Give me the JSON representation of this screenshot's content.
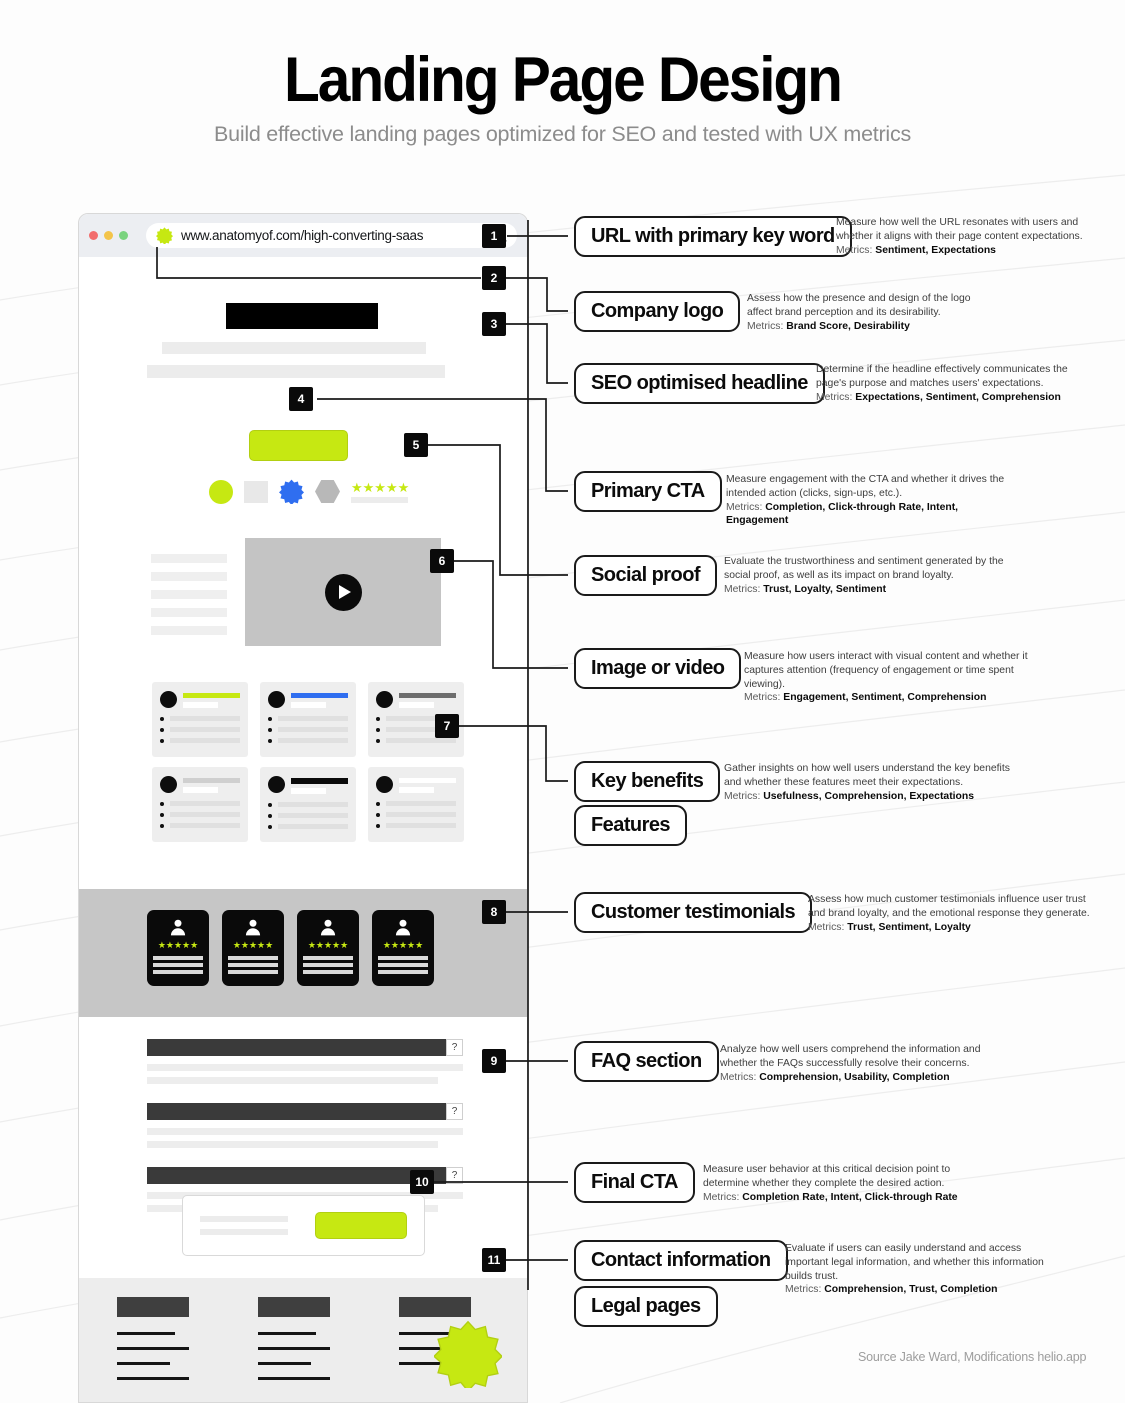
{
  "header": {
    "title": "Landing Page Design",
    "subtitle": "Build effective landing pages optimized for SEO and tested with UX metrics"
  },
  "browser": {
    "url": "www.anatomyof.com/high-converting-saas",
    "search_icon": "search-icon",
    "logo_icon": "burst-logo-icon",
    "traffic_lights": [
      "red",
      "yellow",
      "green"
    ]
  },
  "wireframe": {
    "play_icon": "play-icon",
    "faq_marker": "?",
    "testimonial_stars": "★★★★★",
    "proof_stars": "★★★★★",
    "card_accent_colors": [
      "#c6e812",
      "#2f6ef0",
      "#6d6d6d",
      "#cfcfcf",
      "#0a0a0a",
      "#ffffff"
    ]
  },
  "colors": {
    "accent_lime": "#c6e812",
    "accent_blue": "#2f6ef0",
    "ink": "#0a0a0a",
    "muted": "#8c8c8c",
    "band_gray": "#c6c6c6",
    "footer_gray": "#ededed"
  },
  "callouts": [
    {
      "number": "1",
      "label": "URL with primary key word",
      "description": "Measure how well the URL resonates with users and whether it aligns with their page content expectations.",
      "metrics_label": "Metrics:",
      "metrics": "Sentiment, Expectations"
    },
    {
      "number": "2",
      "label": "Company logo",
      "description": "Assess how the presence and design of the logo affect brand perception and its desirability.",
      "metrics_label": "Metrics:",
      "metrics": "Brand Score, Desirability"
    },
    {
      "number": "3",
      "label": "SEO optimised headline",
      "description": "Determine if the headline effectively communicates the page's purpose and matches users' expectations.",
      "metrics_label": "Metrics:",
      "metrics": "Expectations, Sentiment, Comprehension"
    },
    {
      "number": "4",
      "label": "Primary CTA",
      "description": "Measure engagement with the CTA and whether it drives the intended action (clicks, sign-ups, etc.).",
      "metrics_label": "Metrics:",
      "metrics": "Completion, Click-through Rate, Intent, Engagement"
    },
    {
      "number": "5",
      "label": "Social proof",
      "description": "Evaluate the trustworthiness and sentiment generated by the social proof, as well as its impact on brand loyalty.",
      "metrics_label": "Metrics:",
      "metrics": "Trust, Loyalty, Sentiment"
    },
    {
      "number": "6",
      "label": "Image or video",
      "description": "Measure how users interact with visual content and whether it captures attention (frequency of engagement or time spent viewing).",
      "metrics_label": "Metrics:",
      "metrics": "Engagement, Sentiment, Comprehension"
    },
    {
      "number": "7",
      "label": "Key benefits",
      "label_secondary": "Features",
      "description": "Gather insights on how well users understand the key benefits and whether these features meet their expectations.",
      "metrics_label": "Metrics:",
      "metrics": "Usefulness, Comprehension, Expectations"
    },
    {
      "number": "8",
      "label": "Customer testimonials",
      "description": "Assess how much customer testimonials influence user trust and brand loyalty, and the emotional response they generate.",
      "metrics_label": "Metrics:",
      "metrics": "Trust, Sentiment, Loyalty"
    },
    {
      "number": "9",
      "label": "FAQ section",
      "description": "Analyze how well users comprehend the information and whether the FAQs successfully resolve their concerns.",
      "metrics_label": "Metrics:",
      "metrics": "Comprehension, Usability, Completion"
    },
    {
      "number": "10",
      "label": "Final CTA",
      "description": "Measure user behavior at this critical decision point to determine whether they complete the desired action.",
      "metrics_label": "Metrics:",
      "metrics": "Completion Rate, Intent, Click-through Rate"
    },
    {
      "number": "11",
      "label": "Contact information",
      "label_secondary": "Legal pages",
      "description": "Evaluate if users can easily understand and access important legal information, and whether this information builds trust.",
      "metrics_label": "Metrics:",
      "metrics": "Comprehension, Trust, Completion"
    }
  ],
  "source": "Source Jake Ward, Modifications helio.app"
}
